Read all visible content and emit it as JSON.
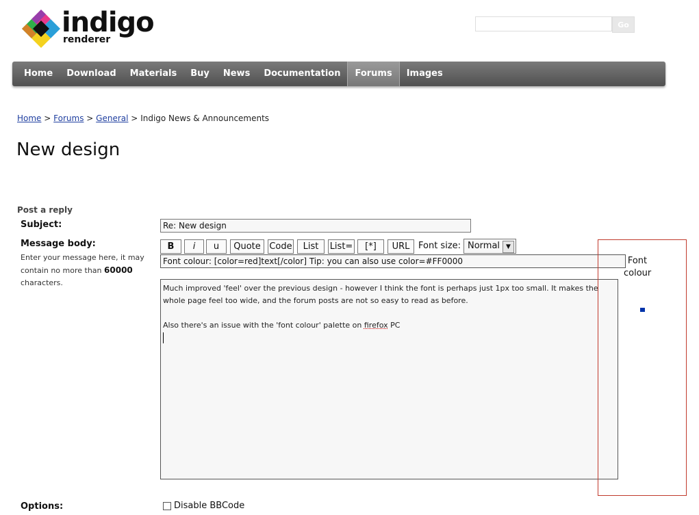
{
  "logo": {
    "word": "indigo",
    "sub": "renderer"
  },
  "search": {
    "placeholder": "",
    "button_label": "Go"
  },
  "nav": {
    "items": [
      {
        "label": "Home"
      },
      {
        "label": "Download"
      },
      {
        "label": "Materials"
      },
      {
        "label": "Buy"
      },
      {
        "label": "News"
      },
      {
        "label": "Documentation"
      },
      {
        "label": "Forums",
        "active": true
      },
      {
        "label": "Images"
      }
    ]
  },
  "breadcrumb": {
    "home": "Home",
    "sep": ">",
    "forums": "Forums",
    "general": "General",
    "current": "Indigo News & Announcements"
  },
  "page_title": "New design",
  "form": {
    "heading": "Post a reply",
    "subject_label": "Subject:",
    "subject_value": "Re: New design",
    "message_label": "Message body:",
    "message_help_pre": "Enter your message here, it may contain no more than",
    "message_help_limit": "60000",
    "message_help_post": "characters.",
    "bbcode_buttons": [
      "B",
      "i",
      "u",
      "Quote",
      "Code",
      "List",
      "List=",
      "[*]",
      "URL"
    ],
    "font_size_label": "Font size:",
    "font_size_value": "Normal",
    "help_line": "Font colour: [color=red]text[/color]  Tip: you can also use color=#FF0000",
    "message_lines": [
      "Much improved 'feel' over the previous design - however I think the font is perhaps just 1px too small. It makes the whole page feel too wide, and the forum posts are not so easy to read as before.",
      "",
      "Also there's an issue with the 'font colour' palette on "
    ],
    "message_spell_word": "firefox",
    "message_tail": " PC",
    "font_colour_label": "Font colour",
    "options_label": "Options:",
    "disable_bbcode_label": "Disable BBCode"
  },
  "colors": {
    "nav_bg": "#5a5a5a",
    "link": "#1f3fa0",
    "palette_border": "#c0392b",
    "swatch": "#0033aa"
  }
}
